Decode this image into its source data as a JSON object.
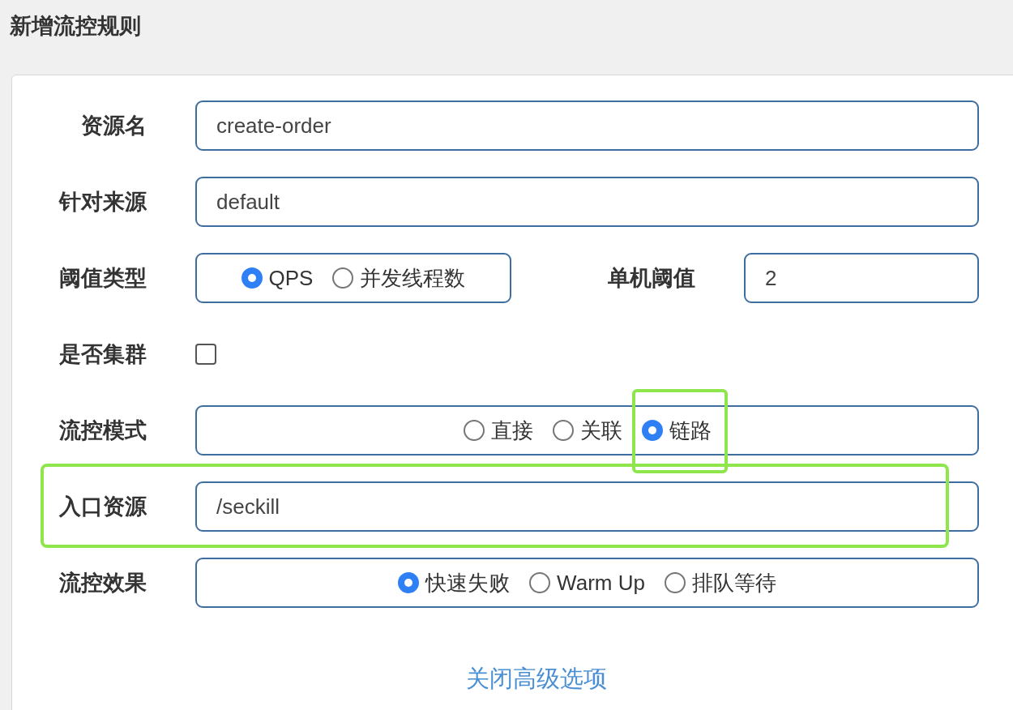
{
  "title": "新增流控规则",
  "form": {
    "rows": [
      {
        "kind": "text",
        "label": "资源名",
        "value": "create-order",
        "highlighted": false
      },
      {
        "kind": "text",
        "label": "针对来源",
        "value": "default",
        "highlighted": false
      },
      {
        "kind": "threshold",
        "label": "阈值类型",
        "options": [
          {
            "label": "QPS",
            "selected": true
          },
          {
            "label": "并发线程数",
            "selected": false
          }
        ],
        "side_label": "单机阈值",
        "side_value": "2"
      },
      {
        "kind": "checkbox",
        "label": "是否集群",
        "checked": false
      },
      {
        "kind": "radio",
        "label": "流控模式",
        "options": [
          {
            "label": "直接",
            "selected": false,
            "highlighted": false
          },
          {
            "label": "关联",
            "selected": false,
            "highlighted": false
          },
          {
            "label": "链路",
            "selected": true,
            "highlighted": true
          }
        ]
      },
      {
        "kind": "text",
        "label": "入口资源",
        "value": "/seckill",
        "highlighted": true
      },
      {
        "kind": "radio",
        "label": "流控效果",
        "options": [
          {
            "label": "快速失败",
            "selected": true,
            "highlighted": false
          },
          {
            "label": "Warm Up",
            "selected": false,
            "highlighted": false
          },
          {
            "label": "排队等待",
            "selected": false,
            "highlighted": false
          }
        ]
      }
    ],
    "link": "关闭高级选项"
  }
}
